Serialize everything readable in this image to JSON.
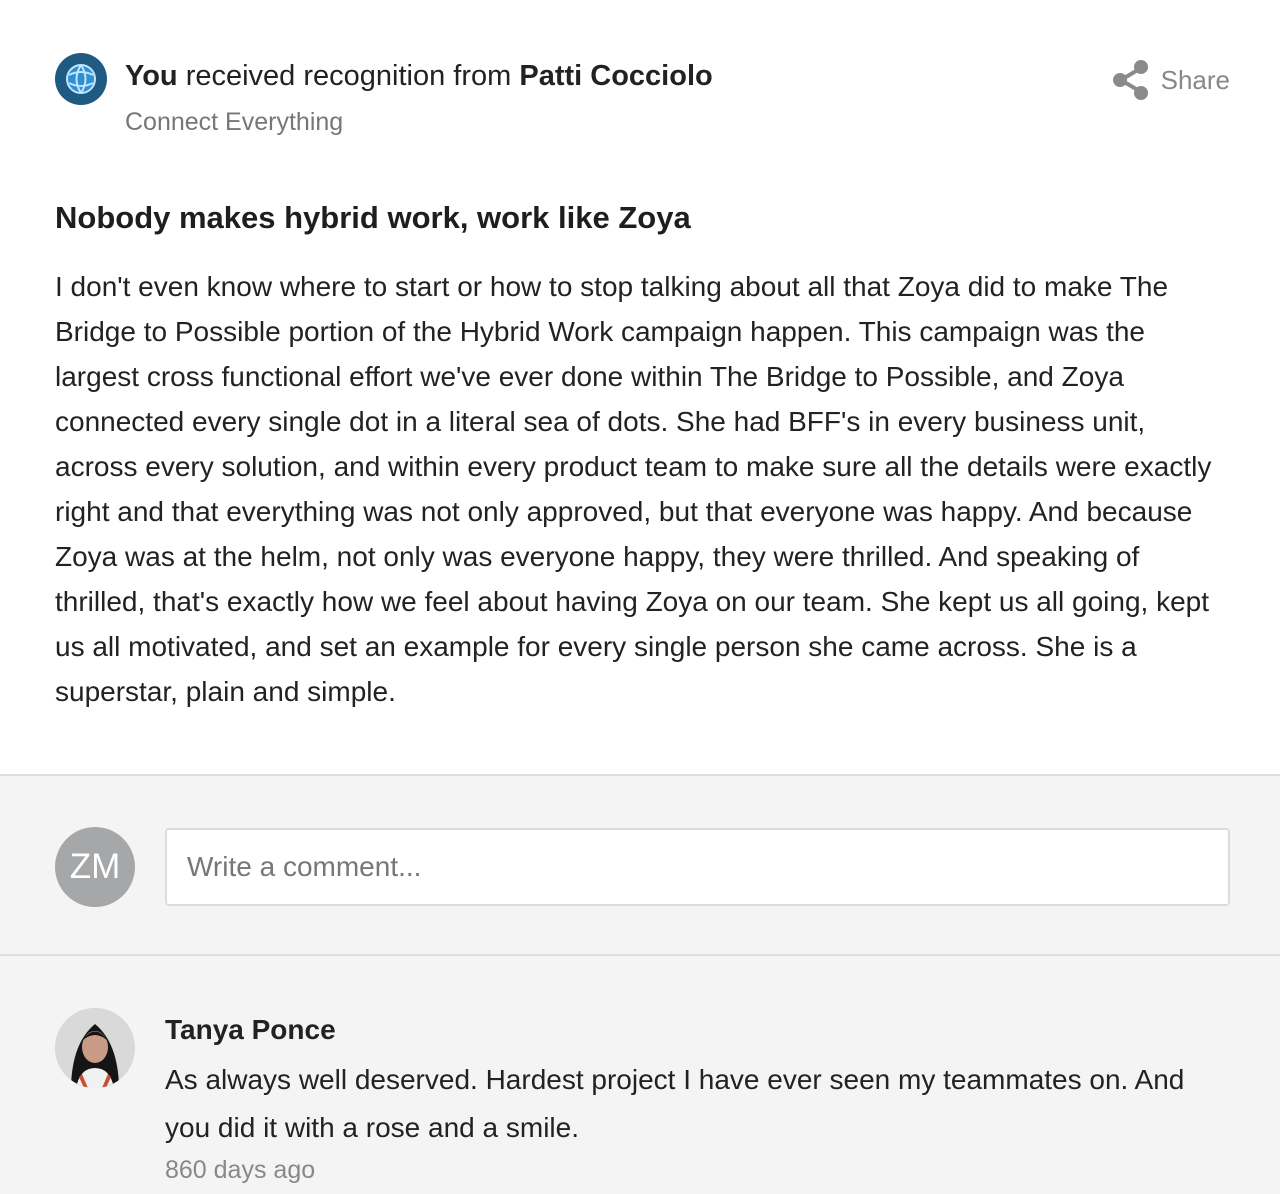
{
  "header": {
    "recipient": "You",
    "action_text": "received recognition from",
    "sender": "Patti Cocciolo",
    "program": "Connect Everything",
    "share_label": "Share",
    "badge_icon": "globe-badge-icon",
    "badge_color": "#1f5a82"
  },
  "message": {
    "title": "Nobody makes hybrid work, work like Zoya",
    "body": "I don't even know where to start or how to stop talking about all that Zoya did to make The Bridge to Possible portion of the Hybrid Work campaign happen. This campaign was the largest cross functional effort we've ever done within The Bridge to Possible, and Zoya connected every single dot in a literal sea of dots. She had BFF's in every business unit, across every solution, and within every product team to make sure all the details were exactly right and that everything was not only approved, but that everyone was happy. And because Zoya was at the helm, not only was everyone happy, they were thrilled. And speaking of thrilled, that's exactly how we feel about having Zoya on our team. She kept us all going, kept us all motivated, and set an example for every single person she came across. She is a superstar, plain and simple."
  },
  "composer": {
    "user_initials": "ZM",
    "placeholder": "Write a comment..."
  },
  "comments": [
    {
      "author": "Tanya Ponce",
      "text": "As always well deserved. Hardest project I have ever seen my teammates on. And you did it with a rose and a smile.",
      "time": "860 days ago"
    }
  ]
}
